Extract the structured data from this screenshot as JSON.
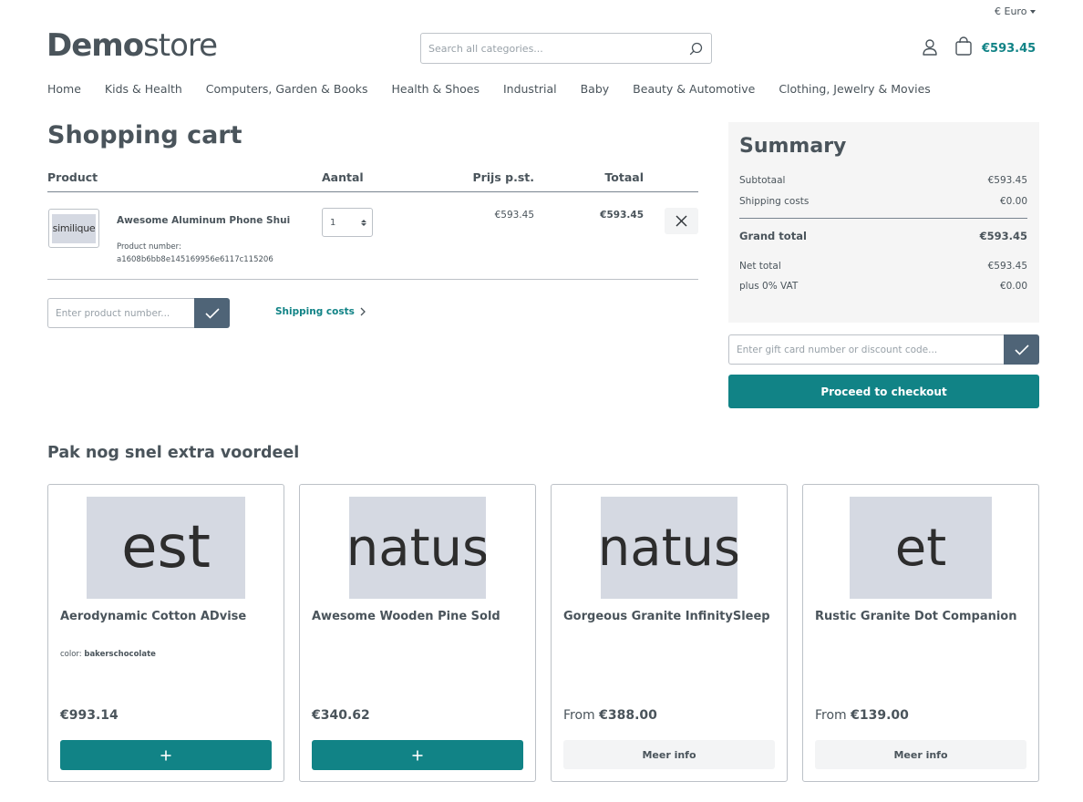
{
  "header": {
    "currency": "€ Euro",
    "logo_bold": "Demo",
    "logo_light": "store",
    "search_placeholder": "Search all categories...",
    "cart_total": "€593.45"
  },
  "nav": [
    "Home",
    "Kids & Health",
    "Computers, Garden & Books",
    "Health & Shoes",
    "Industrial",
    "Baby",
    "Beauty & Automotive",
    "Clothing, Jewelry & Movies"
  ],
  "cart": {
    "title": "Shopping cart",
    "columns": {
      "product": "Product",
      "quantity": "Aantal",
      "unit_price": "Prijs p.st.",
      "total": "Totaal"
    },
    "items": [
      {
        "thumb_text": "similique",
        "name": "Awesome Aluminum Phone Shui",
        "number_label": "Product number:",
        "number": "a1608b6bb8e145169956e6117c115206",
        "quantity": "1",
        "unit_price": "€593.45",
        "total": "€593.45"
      }
    ],
    "add_product_placeholder": "Enter product number...",
    "shipping_link": "Shipping costs"
  },
  "summary": {
    "title": "Summary",
    "subtotal_label": "Subtotaal",
    "subtotal": "€593.45",
    "shipping_label": "Shipping costs",
    "shipping": "€0.00",
    "grand_total_label": "Grand total",
    "grand_total": "€593.45",
    "net_total_label": "Net total",
    "net_total": "€593.45",
    "vat_label": "plus 0% VAT",
    "vat": "€0.00",
    "voucher_placeholder": "Enter gift card number or discount code...",
    "checkout_label": "Proceed to checkout"
  },
  "cross_sell": {
    "title": "Pak nog snel extra voordeel",
    "products": [
      {
        "img_text": "est",
        "name": "Aerodynamic Cotton ADvise",
        "option_label": "color:",
        "option_value": "bakerschocolate",
        "price_prefix": "",
        "price": "€993.14",
        "action": "add"
      },
      {
        "img_text": "natus",
        "name": "Awesome Wooden Pine Sold",
        "option_label": "",
        "option_value": "",
        "price_prefix": "",
        "price": "€340.62",
        "action": "add"
      },
      {
        "img_text": "natus",
        "name": "Gorgeous Granite InfinitySleep",
        "option_label": "",
        "option_value": "",
        "price_prefix": "From",
        "price": "€388.00",
        "action": "Meer info"
      },
      {
        "img_text": "et",
        "name": "Rustic Granite Dot Companion",
        "option_label": "",
        "option_value": "",
        "price_prefix": "From",
        "price": "€139.00",
        "action": "Meer info"
      }
    ]
  },
  "colors": {
    "accent": "#118386",
    "button_dark": "#4f6477",
    "text": "#4a545b"
  }
}
